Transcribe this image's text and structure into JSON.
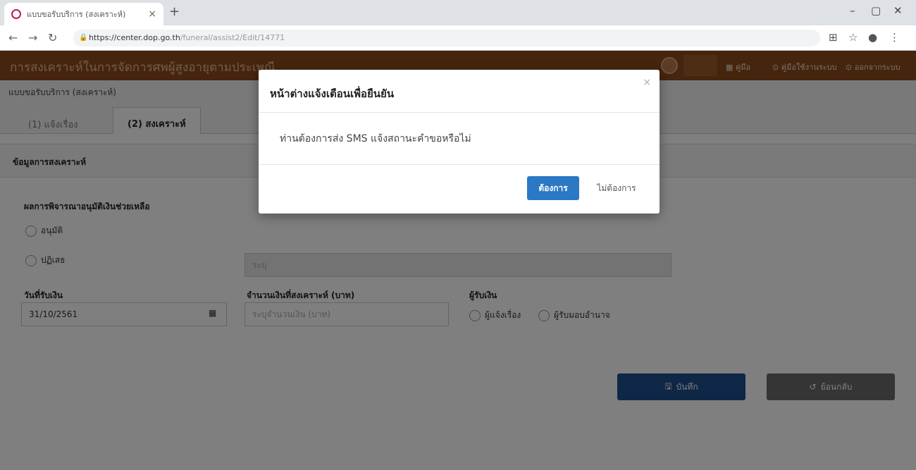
{
  "browser": {
    "tab_title": "แบบขอรับบริการ (สงเคราะห์)",
    "new_tab": "+",
    "url_host": "https://center.dop.go.th",
    "url_path": "/funeral/assist2/Edit/14771",
    "window": {
      "minimize": "–",
      "restore": "▢",
      "close": "✕"
    }
  },
  "app": {
    "title": "การสงเคราะห์ในการจัดการศพผู้สูงอายุตามประเพณี",
    "header_links": [
      "คู่มือ",
      "คู่มือใช้งานระบบ",
      "ออกจากระบบ"
    ]
  },
  "page": {
    "breadcrumb": "แบบขอรับบริการ (สงเคราะห์)",
    "tabs": [
      {
        "label": "(1) แจ้งเรื่อง"
      },
      {
        "label": "(2) สงเคราะห์"
      }
    ],
    "section_title": "ข้อมูลการสงเคราะห์",
    "consider_label": "ผลการพิจารณาอนุมัติเงินช่วยเหลือ",
    "options": [
      "อนุมัติ",
      "ปฏิเสธ"
    ],
    "reason_placeholder": "ระบุ",
    "date_label": "วันที่รับเงิน",
    "date_value": "31/10/2561",
    "amount_label": "จำนวนเงินที่สงเคราะห์ (บาท)",
    "amount_placeholder": "ระบุจำนวนเงิน (บาท)",
    "recipient_label": "ผู้รับเงิน",
    "recipients": [
      "ผู้แจ้งเรื่อง",
      "ผู้รับมอบอำนาจ"
    ],
    "save_label": "บันทึก",
    "back_label": "ย้อนกลับ"
  },
  "modal": {
    "title": "หน้าต่างแจ้งเตือนเพื่อยืนยัน",
    "message": "ท่านต้องการส่ง SMS แจ้งสถานะคำขอหรือไม่",
    "confirm_label": "ต้องการ",
    "decline_label": "ไม่ต้องการ",
    "close": "×"
  },
  "colors": {
    "header": "#8a4b1c",
    "primary": "#2b78c4",
    "save": "#1f4e8f",
    "back": "#6b6b6b"
  }
}
